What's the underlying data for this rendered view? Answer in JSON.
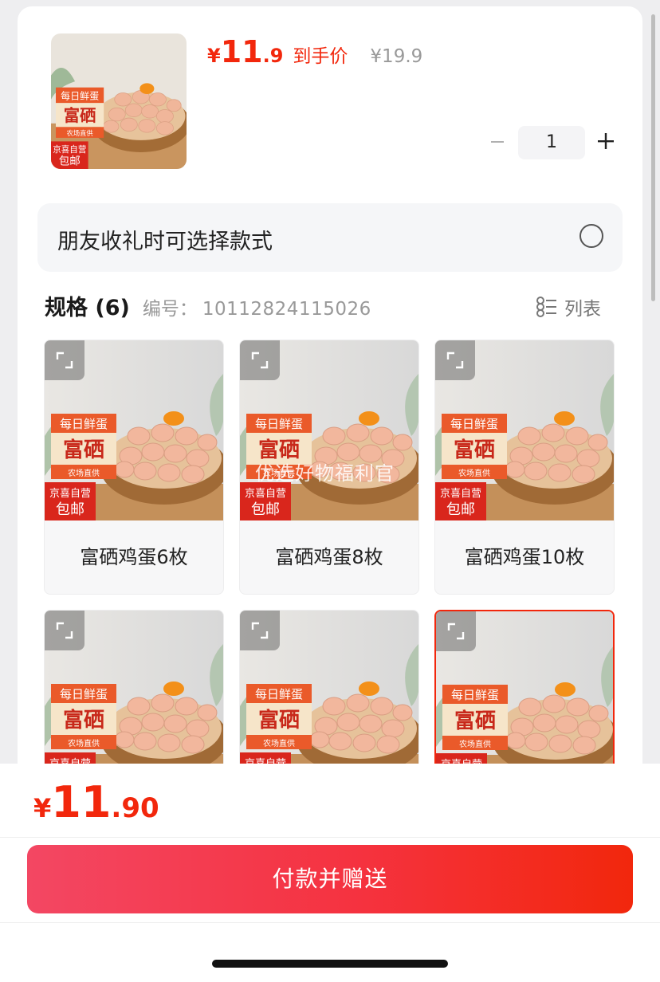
{
  "product": {
    "price_yen": "¥",
    "price_int": "11",
    "price_dec": ".9",
    "price_tag": "到手价",
    "original_price": "¥19.9",
    "quantity": "1",
    "thumb_labels": {
      "top": "每日鲜蛋",
      "brand": "富硒",
      "sub": "农场直供",
      "self": "京喜自营",
      "ship": "包邮"
    }
  },
  "gift_option": {
    "label": "朋友收礼时可选择款式",
    "checked": false
  },
  "spec": {
    "title": "规格 (6)",
    "code_label": "编号：",
    "code": "10112824115026",
    "list_toggle_label": "列表",
    "items": [
      {
        "name": "富硒鸡蛋6枚"
      },
      {
        "name": "富硒鸡蛋8枚"
      },
      {
        "name": "富硒鸡蛋10枚"
      },
      {
        "name": ""
      },
      {
        "name": ""
      },
      {
        "name": ""
      }
    ],
    "selected_index": 5,
    "watermark": "优选好物福利官"
  },
  "bottom": {
    "total_yen": "¥",
    "total_int": "11",
    "total_dec": ".90",
    "pay_button": "付款并赠送"
  },
  "colors": {
    "accent": "#f2270c",
    "button_start": "#f34763",
    "button_end": "#f2270c"
  }
}
